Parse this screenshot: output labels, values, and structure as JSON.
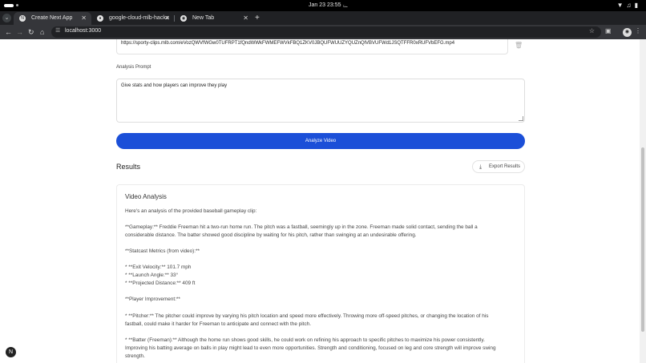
{
  "system": {
    "clock": "Jan 23  23:55"
  },
  "tabs": [
    {
      "title": "Create Next App",
      "active": true
    },
    {
      "title": "google-cloud-mlb-hacka",
      "active": false
    },
    {
      "title": "New Tab",
      "active": false
    }
  ],
  "address_bar": {
    "url": "localhost:3000"
  },
  "form": {
    "video_url": "https://sporty-clips.mlb.com/eVozQWVfWGw0TUFRPT1fQndWWkFWMEFWVkFBQ1ZKV0JBQUFWUUZYQUZnQlVBVUFWd1JSQTFFR0xRUFVbEFG.mp4",
    "prompt_label": "Analysis Prompt",
    "prompt_value": "Give stats and how players can improve they play",
    "analyze_button": "Analyze Video"
  },
  "results": {
    "heading": "Results",
    "export_button": "Export Results",
    "card_title": "Video Analysis",
    "lines": [
      "Here's an analysis of the provided baseball gameplay clip:",
      "",
      "**Gameplay:** Freddie Freeman hit a two-run home run. The pitch was a fastball, seemingly up in the zone. Freeman made solid contact, sending the ball a",
      "considerable distance.  The batter showed good discipline by waiting for his pitch, rather than swinging at an undesirable offering.",
      "",
      "**Statcast Metrics (from video):**",
      "",
      "* **Exit Velocity:** 101.7 mph",
      "* **Launch Angle:** 33°",
      "* **Projected Distance:** 409 ft",
      "",
      "**Player Improvement:**",
      "",
      "* **Pitcher:**  The pitcher could improve by varying his pitch location and speed more effectively.  Throwing more off-speed pitches, or changing the location of his",
      "fastball, could make it harder for Freeman to anticipate and connect with the pitch.",
      "",
      "* **Batter (Freeman):** Although the home run shows good skills, he could work on refining his approach to specific pitches to maximize his power consistently.",
      "Improving his batting average on balls in play might lead to even more opportunities.  Strength and conditioning, focused on leg and core strength will improve swing",
      "strength."
    ]
  },
  "colors": {
    "accent": "#1b4fd8",
    "chrome_dark": "#202124",
    "chrome_mid": "#35363a"
  }
}
